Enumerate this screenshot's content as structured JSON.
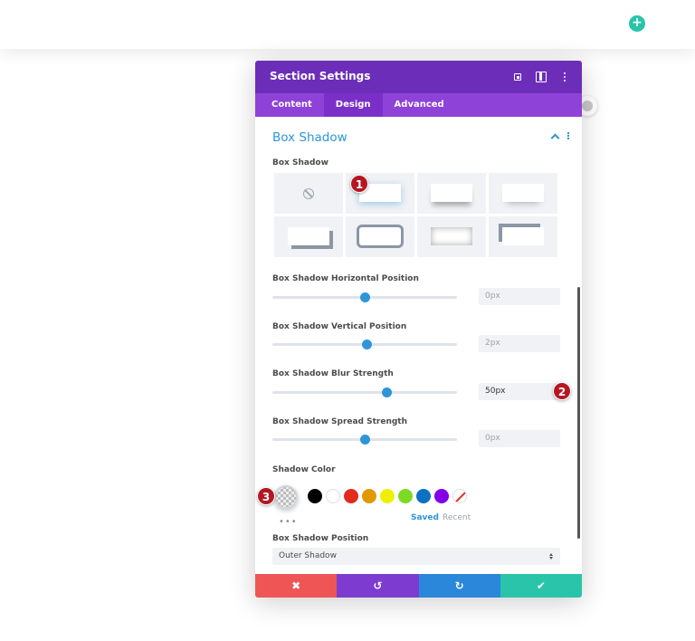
{
  "topbar": {
    "add_icon": "plus-icon",
    "add_color": "#29c4a9"
  },
  "modal": {
    "title": "Section Settings",
    "header_icons": [
      "target-icon",
      "columns-icon",
      "more-vertical-icon"
    ],
    "colors": {
      "header": "#6c2eb9",
      "tabs": "#8e42d8",
      "accent": "#2e95d8"
    },
    "tabs": [
      {
        "label": "Content",
        "active": false
      },
      {
        "label": "Design",
        "active": true
      },
      {
        "label": "Advanced",
        "active": false
      }
    ],
    "section": {
      "title": "Box Shadow",
      "preset_label": "Box Shadow",
      "presets": [
        "none",
        "outer-glow",
        "drop-bottom",
        "soft-bottom",
        "corner-offset",
        "border-outline",
        "inset",
        "top-left-offset"
      ],
      "selected_preset": 1,
      "sliders": [
        {
          "label": "Box Shadow Horizontal Position",
          "value": "0px",
          "level": 0.5,
          "set": false
        },
        {
          "label": "Box Shadow Vertical Position",
          "value": "2px",
          "level": 0.51,
          "set": false
        },
        {
          "label": "Box Shadow Blur Strength",
          "value": "50px",
          "level": 0.62,
          "set": true
        },
        {
          "label": "Box Shadow Spread Strength",
          "value": "0px",
          "level": 0.5,
          "set": false
        }
      ],
      "shadow_color_label": "Shadow Color",
      "swatches": [
        "#000000",
        "#ffffff",
        "#e02b20",
        "#e09900",
        "#edf000",
        "#7cda24",
        "#0c71c3",
        "#8300e9"
      ],
      "more_dots": "•••",
      "saved_label": "Saved",
      "recent_label": "Recent",
      "position_label": "Box Shadow Position",
      "position_value": "Outer Shadow"
    },
    "footer": {
      "cancel": "✖",
      "undo": "↺",
      "redo": "↻",
      "save": "✔",
      "colors": [
        "#ef5555",
        "#7e3bd0",
        "#2b87da",
        "#29c4a9"
      ]
    }
  },
  "badges": [
    "1",
    "2",
    "3"
  ]
}
